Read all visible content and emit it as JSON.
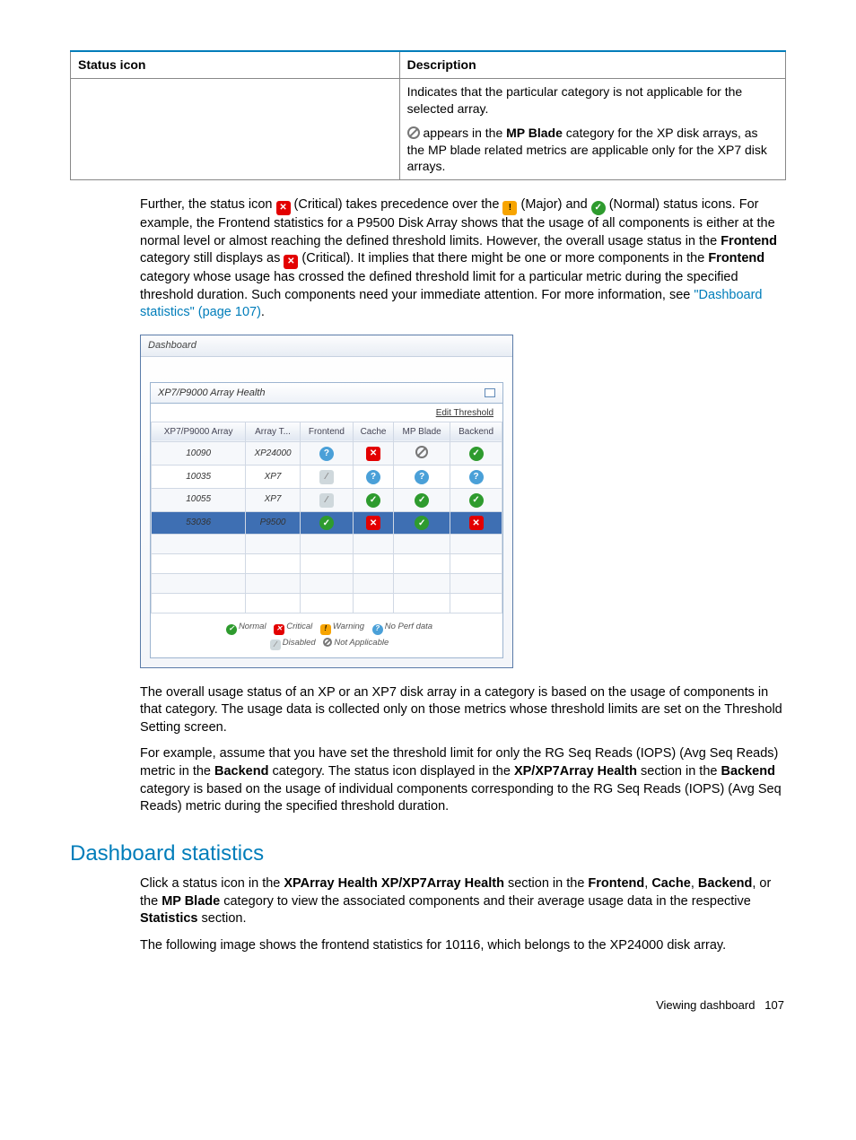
{
  "status_table": {
    "header_icon": "Status icon",
    "header_desc": "Description",
    "row": {
      "line1": "Indicates that the particular category is not applicable for the selected array.",
      "line2a": " appears in the ",
      "line2b": "MP Blade",
      "line2c": " category for the XP disk arrays, as the MP blade related metrics are applicable only for the XP7 disk arrays."
    }
  },
  "para1": {
    "t1": "Further, the status icon ",
    "t2": " (Critical) takes precedence over the ",
    "t3": " (Major) and ",
    "t4": " (Normal) status icons. For example, the Frontend statistics for a P9500 Disk Array shows that the usage of all components is either at the normal level or almost reaching the defined threshold limits. However, the overall usage status in the ",
    "t5": "Frontend",
    "t6": " category still displays as ",
    "t7": " (Critical). It implies that there might be one or more components in the ",
    "t8": "Frontend",
    "t9": " category whose usage has crossed the defined threshold limit for a particular metric during the specified threshold duration. Such components need your immediate attention. For more information, see ",
    "link": "\"Dashboard statistics\" (page 107)",
    "t10": "."
  },
  "dashboard": {
    "title": "Dashboard",
    "panel_title": "XP7/P9000 Array Health",
    "edit": "Edit Threshold",
    "cols": [
      "XP7/P9000 Array",
      "Array T...",
      "Frontend",
      "Cache",
      "MP Blade",
      "Backend"
    ],
    "rows": [
      {
        "id": "10090",
        "type": "XP24000",
        "cells": [
          "noperf",
          "critical",
          "na",
          "normal"
        ]
      },
      {
        "id": "10035",
        "type": "XP7",
        "cells": [
          "disabled",
          "noperf",
          "noperf",
          "noperf"
        ]
      },
      {
        "id": "10055",
        "type": "XP7",
        "cells": [
          "disabled",
          "normal",
          "normal",
          "normal"
        ]
      },
      {
        "id": "53036",
        "type": "P9500",
        "cells": [
          "normal",
          "critical",
          "normal",
          "critical"
        ],
        "selected": true
      }
    ],
    "legend": {
      "normal": "Normal",
      "critical": "Critical",
      "warning": "Warning",
      "noperf": "No Perf data",
      "disabled": "Disabled",
      "na": "Not Applicable"
    }
  },
  "para2": "The overall usage status of an XP or an XP7 disk array in a category is based on the usage of components in that category. The usage data is collected only on those metrics whose threshold limits are set on the Threshold Setting screen.",
  "para3": {
    "t1": "For example, assume that you have set the threshold limit for only the RG Seq Reads (IOPS) (Avg Seq Reads) metric in the ",
    "b1": "Backend",
    "t2": " category. The status icon displayed in the ",
    "b2": "XP/XP7Array Health",
    "t3": " section in the ",
    "b3": "Backend",
    "t4": " category is based on the usage of individual components corresponding to the RG Seq Reads (IOPS) (Avg Seq Reads) metric during the specified threshold duration."
  },
  "heading": "Dashboard statistics",
  "para4": {
    "t1": "Click a status icon in the ",
    "b1": "XPArray Health XP/XP7Array Health",
    "t2": " section in the ",
    "b2": "Frontend",
    "t3": ", ",
    "b3": "Cache",
    "t4": ", ",
    "b4": "Backend",
    "t5": ", or the ",
    "b5": "MP Blade",
    "t6": " category to view the associated components and their average usage data in the respective ",
    "b6": "Statistics",
    "t7": " section."
  },
  "para5": "The following image shows the frontend statistics for 10116, which belongs to the XP24000 disk array.",
  "footer": {
    "label": "Viewing dashboard",
    "page": "107"
  }
}
